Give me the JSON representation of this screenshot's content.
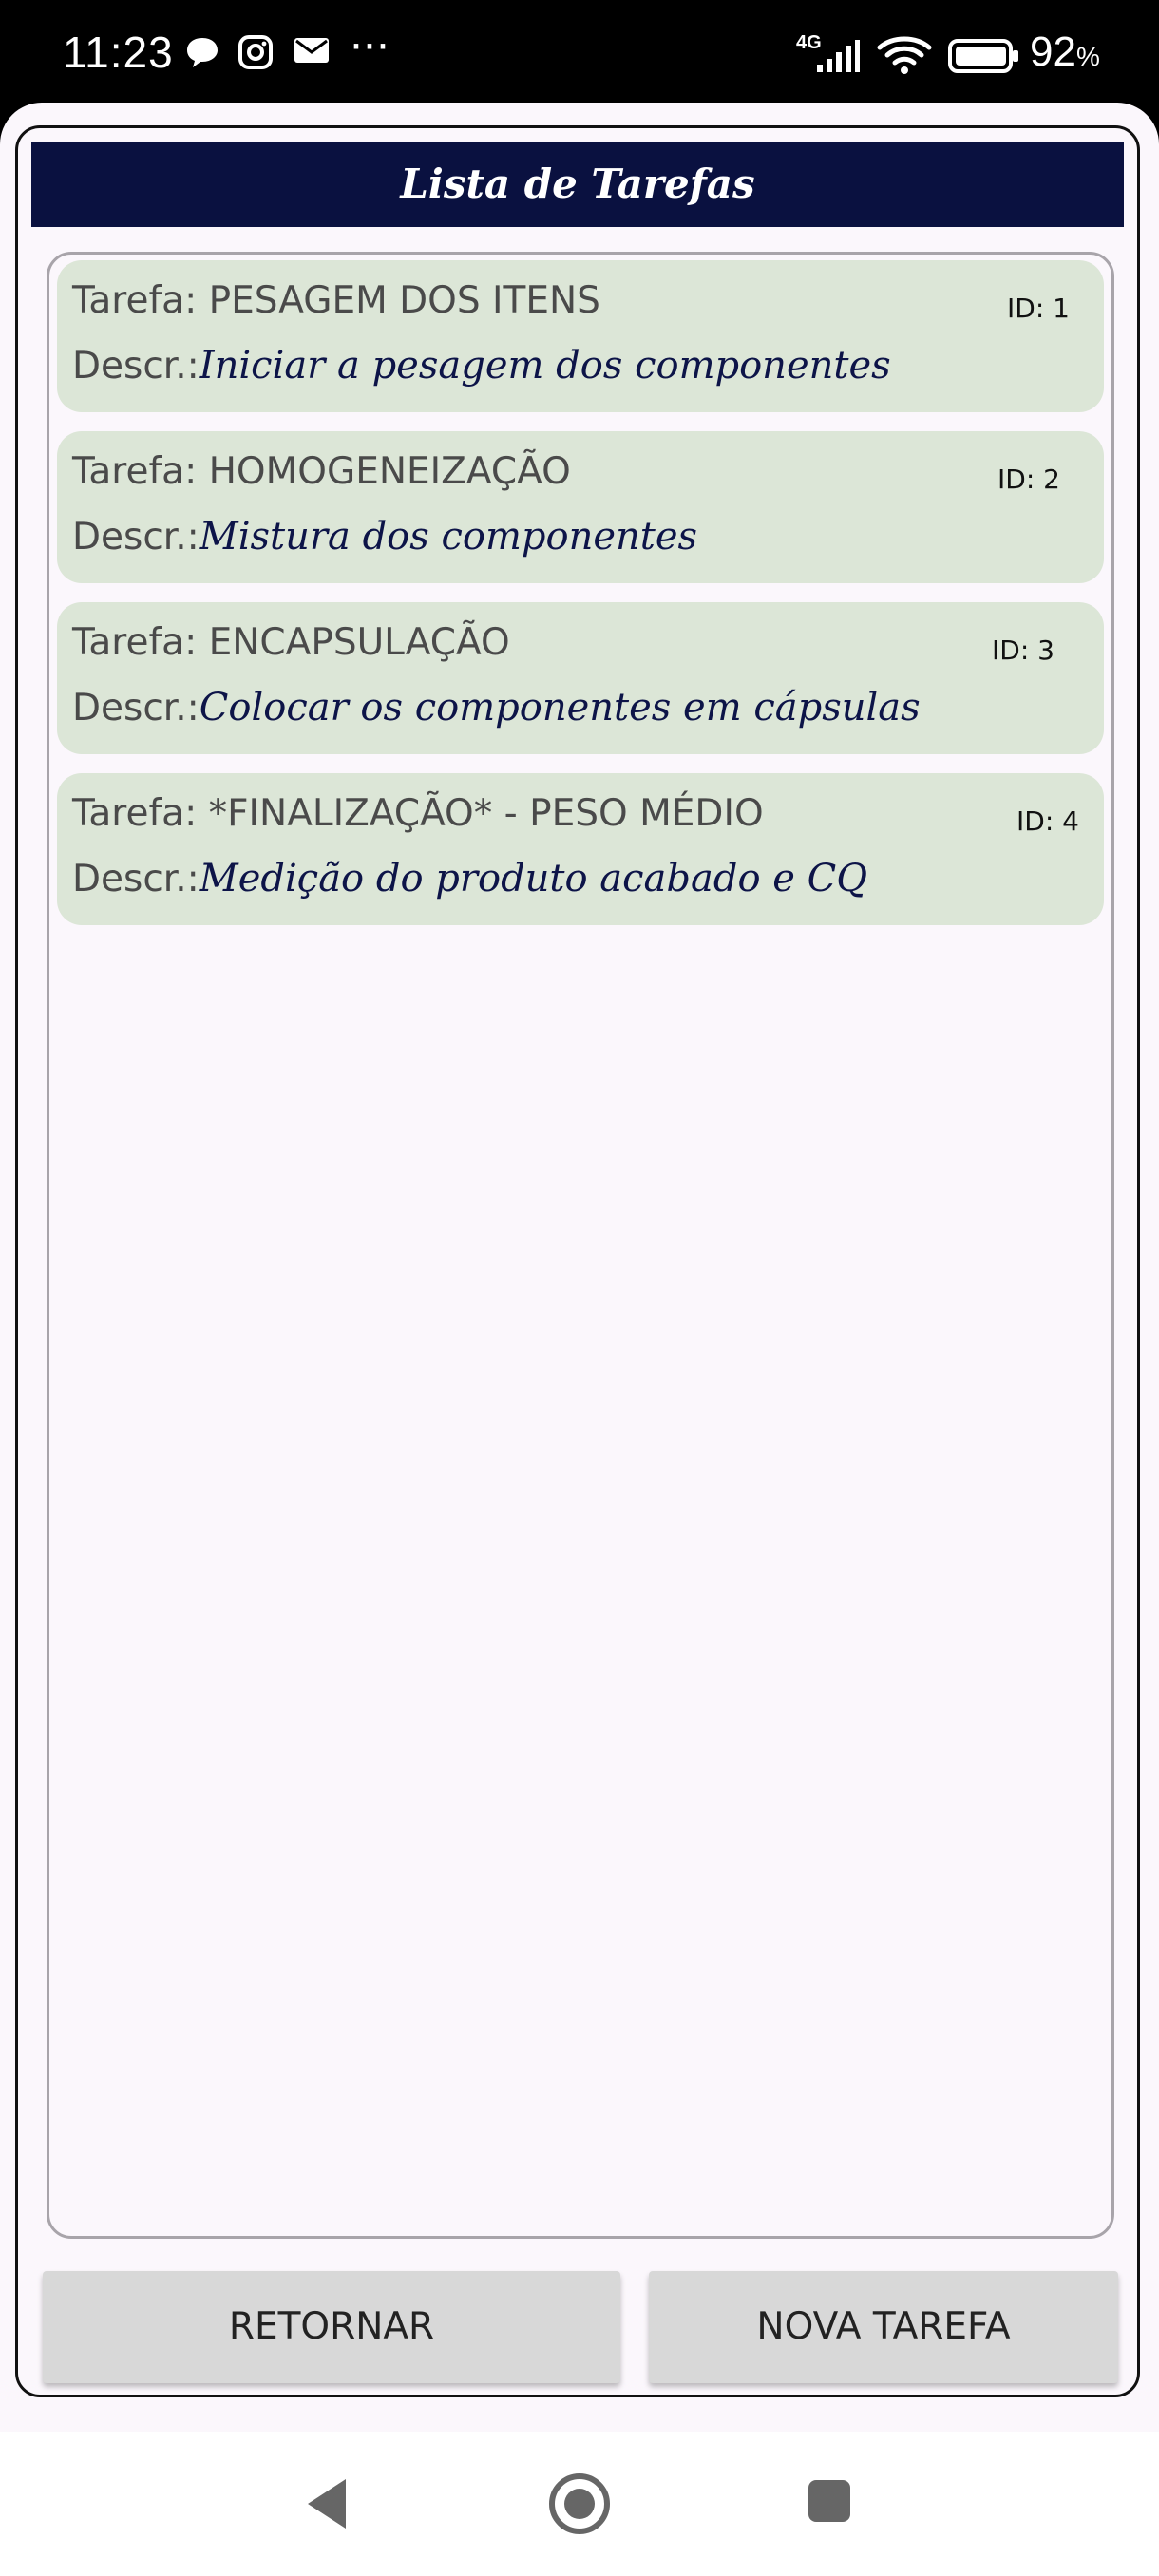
{
  "status_bar": {
    "time": "11:23",
    "network": "4G",
    "battery_percent": "92",
    "battery_unit": "%",
    "notification_icons": [
      "chat-bubble-icon",
      "instagram-icon",
      "mail-icon"
    ],
    "more_indicator": "···"
  },
  "app": {
    "title": "Lista de Tarefas",
    "tasks": [
      {
        "title": "Tarefa: PESAGEM DOS ITENS",
        "id": "ID: 1",
        "desc_label": "Descr.:",
        "desc": "Iniciar a pesagem dos componentes"
      },
      {
        "title": "Tarefa: HOMOGENEIZAÇÃO",
        "id": "ID: 2",
        "desc_label": "Descr.:",
        "desc": "Mistura dos componentes"
      },
      {
        "title": "Tarefa: ENCAPSULAÇÃO",
        "id": "ID: 3",
        "desc_label": "Descr.:",
        "desc": "Colocar os componentes em cápsulas"
      },
      {
        "title": "Tarefa: *FINALIZAÇÃO* - PESO MÉDIO",
        "id": "ID: 4",
        "desc_label": "Descr.:",
        "desc": "Medição do produto acabado e CQ"
      }
    ],
    "buttons": {
      "return_label": "RETORNAR",
      "new_task_label": "NOVA TAREFA"
    }
  },
  "colors": {
    "title_bar_bg": "#0a1140",
    "card_bg": "#dce6d7",
    "button_bg": "#d8d8d8",
    "page_bg": "#fbf7fc"
  }
}
